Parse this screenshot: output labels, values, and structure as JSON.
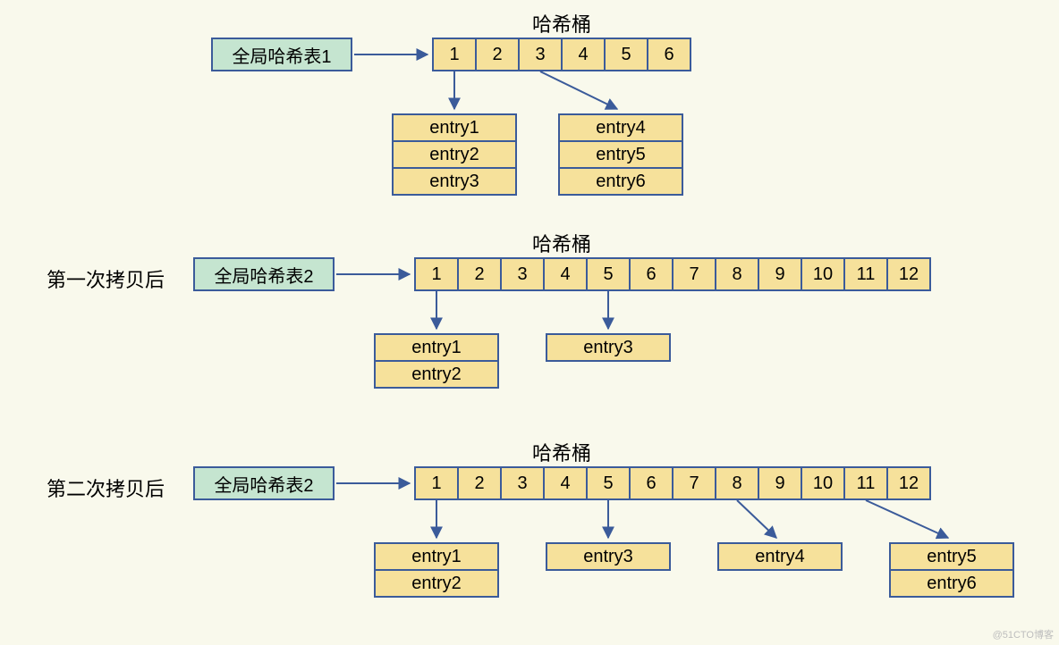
{
  "watermark": "@51CTO博客",
  "labels": {
    "hashBucket": "哈希桶",
    "table1": "全局哈希表1",
    "table2": "全局哈希表2",
    "phase1": "第一次拷贝后",
    "phase2": "第二次拷贝后"
  },
  "entries": {
    "e1": "entry1",
    "e2": "entry2",
    "e3": "entry3",
    "e4": "entry4",
    "e5": "entry5",
    "e6": "entry6"
  },
  "buckets6": [
    "1",
    "2",
    "3",
    "4",
    "5",
    "6"
  ],
  "buckets12": [
    "1",
    "2",
    "3",
    "4",
    "5",
    "6",
    "7",
    "8",
    "9",
    "10",
    "11",
    "12"
  ],
  "chart_data": {
    "type": "diagram",
    "title": "Redis global hash table rehashing (progressive copy)",
    "stages": [
      {
        "name": "initial",
        "label": "全局哈希表1",
        "bucket_count": 6,
        "chains": {
          "1": [
            "entry1",
            "entry2",
            "entry3"
          ],
          "3": [
            "entry4",
            "entry5",
            "entry6"
          ]
        }
      },
      {
        "name": "after_first_copy",
        "phase_label": "第一次拷贝后",
        "label": "全局哈希表2",
        "bucket_count": 12,
        "chains": {
          "1": [
            "entry1",
            "entry2"
          ],
          "5": [
            "entry3"
          ]
        }
      },
      {
        "name": "after_second_copy",
        "phase_label": "第二次拷贝后",
        "label": "全局哈希表2",
        "bucket_count": 12,
        "chains": {
          "1": [
            "entry1",
            "entry2"
          ],
          "5": [
            "entry3"
          ],
          "8": [
            "entry4"
          ],
          "11": [
            "entry5",
            "entry6"
          ]
        }
      }
    ]
  }
}
